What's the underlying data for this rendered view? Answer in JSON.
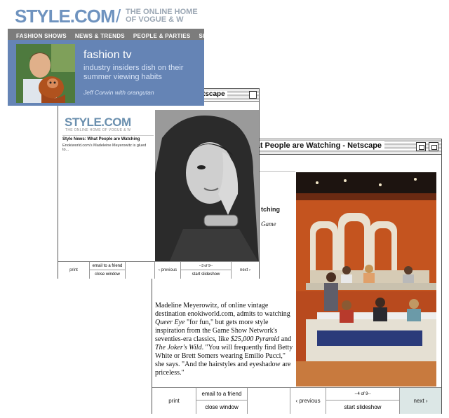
{
  "banner": {
    "brand": "STYLE.COM",
    "slash": "/",
    "tagline": "THE ONLINE HOME OF VOGUE & W",
    "nav": [
      "FASHION SHOWS",
      "NEWS & TRENDS",
      "PEOPLE & PARTIES",
      "SHO"
    ],
    "feature": {
      "title": "fashion tv",
      "subtitle": "industry insiders dish on their summer viewing habits",
      "caption": "Jeff Corwin with orangutan"
    }
  },
  "window_mid": {
    "title": "tscape",
    "logo": "STYLE.COM",
    "logo_tag": "THE ONLINE HOME OF VOGUE & W",
    "section": "Style News: What People are Watching",
    "blurb": "Enokiworld.com's Madeleine Meyerowitz is glued to...",
    "footer": {
      "print": "print",
      "email": "email to a friend",
      "close": "close window",
      "previous": "‹ previous",
      "counter": "--3 of 9--",
      "slideshow": "start slideshow",
      "next": "next ›"
    }
  },
  "window_front": {
    "title": "hat People are Watching - Netscape",
    "fragment_1": "tching",
    "fragment_2": "Game",
    "caption_parts": {
      "a": "Madeline Meyerowitz, of online vintage destination enokiworld.com, admits to watching ",
      "b": "Queer Eye",
      "c": " \"for fun,\" but gets more style inspiration from the Game Show Network's seventies-era classics, like ",
      "d": "$25,000 Pyramid",
      "e": " and ",
      "f": "The Joker's Wild",
      "g": ". \"You will frequently find Betty White or Brett Somers wearing Emilio Pucci,\" she says. \"And the hairstyles and eyeshadow are priceless.\""
    },
    "footer": {
      "print": "print",
      "email": "email to a friend",
      "close": "close window",
      "previous": "‹ previous",
      "counter": "--4 of 9--",
      "slideshow": "start slideshow",
      "next": "next ›"
    }
  }
}
